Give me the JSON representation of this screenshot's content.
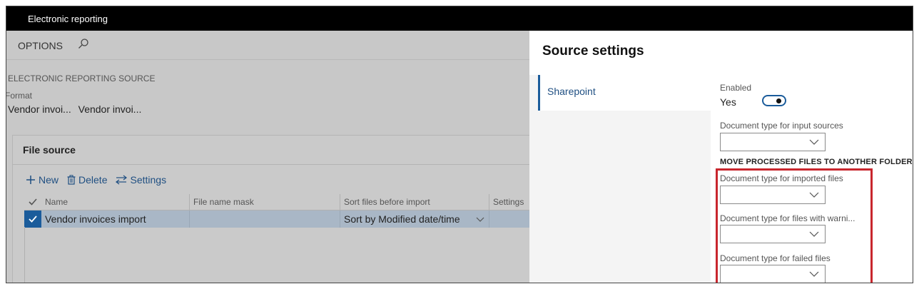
{
  "window": {
    "title": "Electronic reporting"
  },
  "actionbar": {
    "options_label": "OPTIONS",
    "search_icon": "search-icon"
  },
  "header": {
    "section_caption": "ELECTRONIC REPORTING SOURCE",
    "format_label": "Format",
    "format_values": [
      "Vendor invoi...",
      "Vendor invoi..."
    ]
  },
  "file_source": {
    "title": "File source",
    "toolbar": {
      "new_label": "New",
      "delete_label": "Delete",
      "settings_label": "Settings"
    },
    "columns": [
      "Name",
      "File name mask",
      "Sort files before import",
      "Settings"
    ],
    "rows": [
      {
        "name": "Vendor invoices import",
        "mask": "",
        "sort": "Sort by Modified date/time",
        "settings": ""
      }
    ]
  },
  "source_settings": {
    "title": "Source settings",
    "nav_items": [
      "Sharepoint"
    ],
    "enabled_label": "Enabled",
    "enabled_value": "Yes",
    "enabled_state": true,
    "input_sources_label": "Document type for input sources",
    "input_sources_value": "",
    "move_section_title": "MOVE PROCESSED FILES TO ANOTHER FOLDER",
    "imported_label": "Document type for imported files",
    "imported_value": "",
    "warnings_label": "Document type for files with warni...",
    "warnings_value": "",
    "failed_label": "Document type for failed files",
    "failed_value": ""
  },
  "colors": {
    "accent": "#1b5c9b",
    "highlight": "#c8262d",
    "titlebar": "#000000",
    "dim_overlay": "#c8c8c8"
  }
}
